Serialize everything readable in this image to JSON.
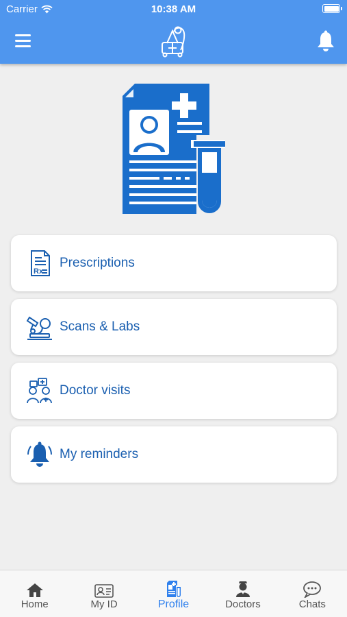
{
  "status_bar": {
    "carrier": "Carrier",
    "time": "10:38 AM"
  },
  "header": {
    "menu_icon": "hamburger-menu-icon",
    "logo_icon": "doctor-app-logo",
    "notification_icon": "bell-icon"
  },
  "hero": {
    "icon": "medical-record-icon",
    "color": "#1a6ecb"
  },
  "menu_items": [
    {
      "label": "Prescriptions",
      "icon": "prescription-icon"
    },
    {
      "label": "Scans & Labs",
      "icon": "microscope-icon"
    },
    {
      "label": "Doctor visits",
      "icon": "doctor-visits-icon"
    },
    {
      "label": "My reminders",
      "icon": "bell-icon"
    }
  ],
  "tabs": [
    {
      "label": "Home",
      "icon": "home-icon",
      "active": false
    },
    {
      "label": "My ID",
      "icon": "id-card-icon",
      "active": false
    },
    {
      "label": "Profile",
      "icon": "profile-document-icon",
      "active": true
    },
    {
      "label": "Doctors",
      "icon": "doctor-icon",
      "active": false
    },
    {
      "label": "Chats",
      "icon": "chat-icon",
      "active": false
    }
  ],
  "colors": {
    "header": "#4f96ee",
    "accent": "#1a5fb0",
    "active_tab": "#2f80ed"
  }
}
